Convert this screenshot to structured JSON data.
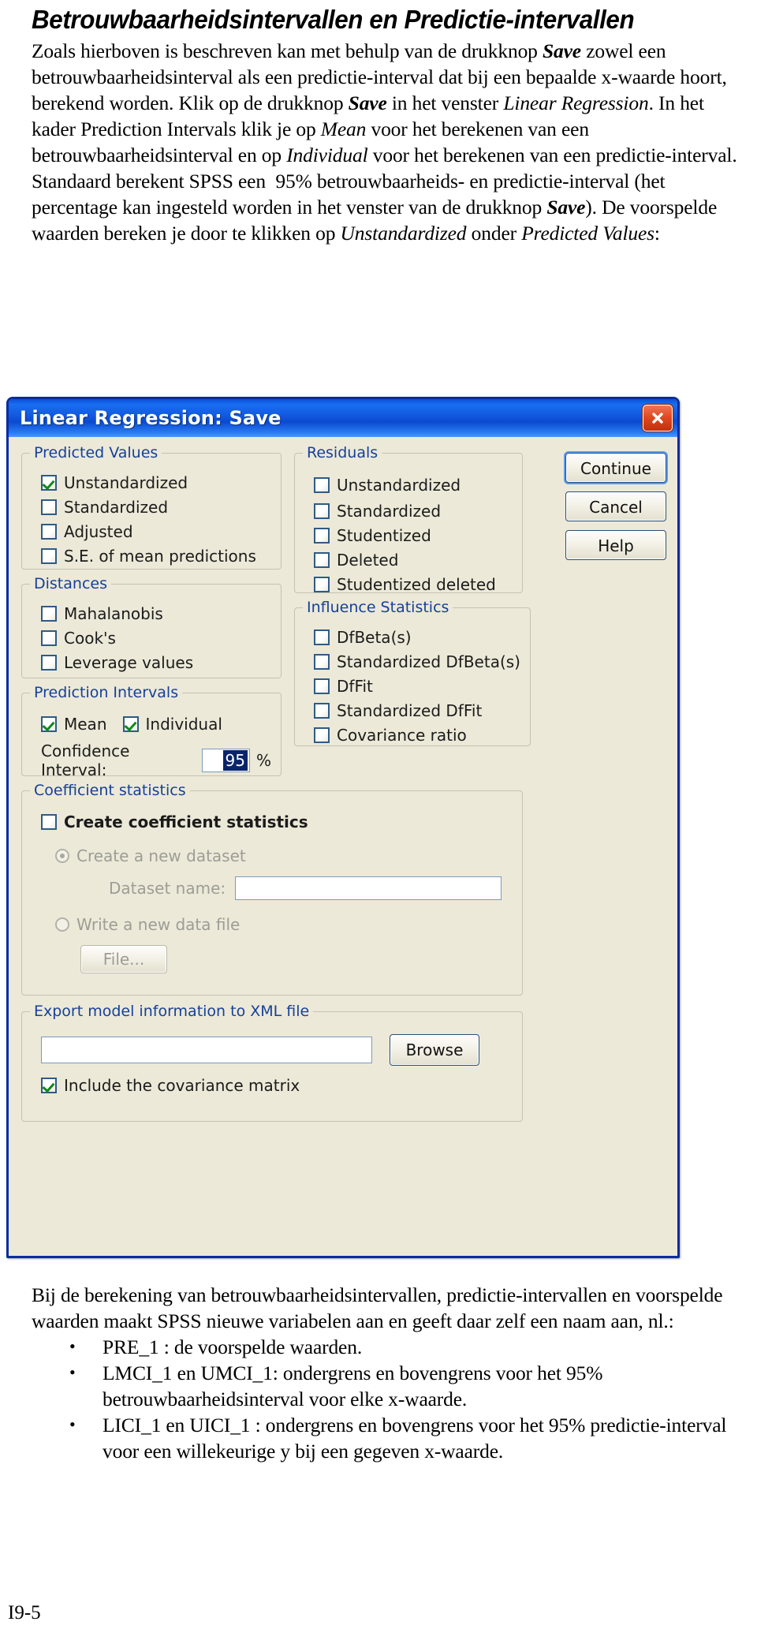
{
  "document": {
    "title": "Betrouwbaarheidsintervallen en Predictie-intervallen",
    "paragraph_html": "Zoals hierboven is beschreven kan met behulp van de drukknop <span class=\"bi\">Save</span> zowel een betrouwbaarheidsinterval als een predictie-interval dat bij een bepaalde x-waarde hoort, berekend worden. Klik op de drukknop <span class=\"bi\">Save</span> in het venster <span class=\"i\">Linear Regression</span>. In het kader Prediction Intervals klik je op <span class=\"i\">Mean</span> voor het berekenen van een betrouwbaarheidsinterval en op <span class=\"i\">Individual</span> voor het berekenen van een predictie-interval. Standaard berekent SPSS een&nbsp; 95% betrouwbaarheids- en predictie-interval (het percentage kan ingesteld worden in het venster van de drukknop <span class=\"bi\">Save</span>). De voorspelde waarden bereken je door te klikken op <span class=\"i\">Unstandardized</span> onder <span class=\"i\">Predicted Values</span>:",
    "closing_paragraph": "Bij de berekening van betrouwbaarheidsintervallen, predictie-intervallen en voorspelde waarden maakt SPSS nieuwe variabelen aan en geeft daar zelf een naam aan, nl.:",
    "bullets": [
      "PRE_1 : de voorspelde waarden.",
      "LMCI_1 en UMCI_1: ondergrens en bovengrens voor het 95% betrouwbaarheidsinterval voor elke x-waarde.",
      "LICI_1 en UICI_1  : ondergrens en bovengrens voor het 95% predictie-interval voor een willekeurige y bij een gegeven x-waarde."
    ],
    "bullet_marker": "•",
    "folio": "I9-5"
  },
  "dialog": {
    "title": "Linear Regression: Save",
    "close_icon": "close-icon",
    "buttons": {
      "continue": "Continue",
      "cancel": "Cancel",
      "help": "Help"
    },
    "predicted_values": {
      "legend": "Predicted Values",
      "items": [
        {
          "label": "Unstandardized",
          "checked": true,
          "accel": "U"
        },
        {
          "label": "Standardized",
          "checked": false,
          "accel": "r"
        },
        {
          "label": "Adjusted",
          "checked": false,
          "accel": "j"
        },
        {
          "label": "S.E. of mean predictions",
          "checked": false,
          "accel": "p"
        }
      ]
    },
    "distances": {
      "legend": "Distances",
      "items": [
        {
          "label": "Mahalanobis",
          "checked": false,
          "accel": "h"
        },
        {
          "label": "Cook's",
          "checked": false,
          "accel": "k"
        },
        {
          "label": "Leverage values",
          "checked": false,
          "accel": "g"
        }
      ]
    },
    "prediction_intervals": {
      "legend": "Prediction Intervals",
      "mean": {
        "label": "Mean",
        "checked": true
      },
      "individual": {
        "label": "Individual",
        "checked": true
      },
      "confidence_label": "Confidence Interval:",
      "confidence_value": "95",
      "percent_sign": "%"
    },
    "residuals": {
      "legend": "Residuals",
      "items": [
        {
          "label": "Unstandardized",
          "checked": false
        },
        {
          "label": "Standardized",
          "checked": false
        },
        {
          "label": "Studentized",
          "checked": false
        },
        {
          "label": "Deleted",
          "checked": false
        },
        {
          "label": "Studentized deleted",
          "checked": false
        }
      ]
    },
    "influence_statistics": {
      "legend": "Influence Statistics",
      "items": [
        {
          "label": "DfBeta(s)",
          "checked": false
        },
        {
          "label": "Standardized DfBeta(s)",
          "checked": false
        },
        {
          "label": "DfFit",
          "checked": false
        },
        {
          "label": "Standardized DfFit",
          "checked": false
        },
        {
          "label": "Covariance ratio",
          "checked": false
        }
      ]
    },
    "coefficient_statistics": {
      "legend": "Coefficient statistics",
      "create_checkbox": {
        "label": "Create coefficient statistics",
        "checked": false
      },
      "create_dataset_radio": {
        "label": "Create a new dataset",
        "selected": true
      },
      "dataset_name_label": "Dataset name:",
      "dataset_name_value": "",
      "write_file_radio": {
        "label": "Write a new data file",
        "selected": false
      },
      "file_button": "File..."
    },
    "export_model": {
      "legend": "Export model information to XML file",
      "path_value": "",
      "browse_button": "Browse",
      "include_cov": {
        "label": "Include the covariance matrix",
        "checked": true
      }
    }
  }
}
